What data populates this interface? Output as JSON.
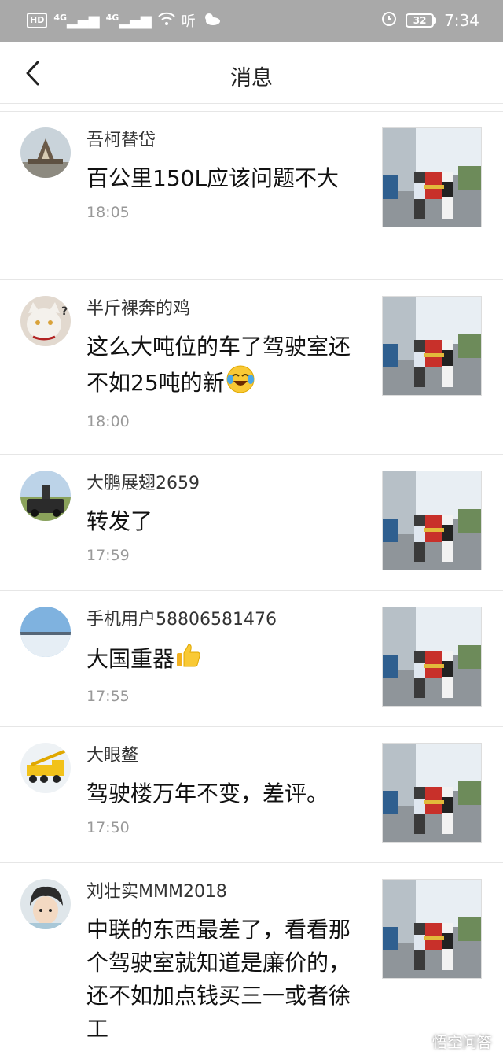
{
  "status_bar": {
    "hd": "HD",
    "net1": "4G",
    "net2": "4G",
    "ting": "听",
    "battery": "32",
    "time": "7:34"
  },
  "header": {
    "title": "消息"
  },
  "messages": [
    {
      "username": "吾柯替岱",
      "comment": "百公里150L应该问题不大",
      "time": "18:05"
    },
    {
      "username": "半斤裸奔的鸡",
      "comment": "这么大吨位的车了驾驶室还不如25吨的新",
      "time": "18:00"
    },
    {
      "username": "大鹏展翅2659",
      "comment": "转发了",
      "time": "17:59"
    },
    {
      "username": "手机用户58806581476",
      "comment": "大国重器",
      "time": "17:55"
    },
    {
      "username": "大眼鳌",
      "comment": "驾驶楼万年不变，差评。",
      "time": "17:50"
    },
    {
      "username": "刘壮实MMM2018",
      "comment": "中联的东西最差了，看看那个驾驶室就知道是廉价的，还不如加点钱买三一或者徐工",
      "time": ""
    }
  ],
  "watermark": "悟空问答",
  "colors": {
    "status_bar": "#a9a9a9",
    "divider": "#e6e6e6",
    "time_text": "#999999"
  }
}
